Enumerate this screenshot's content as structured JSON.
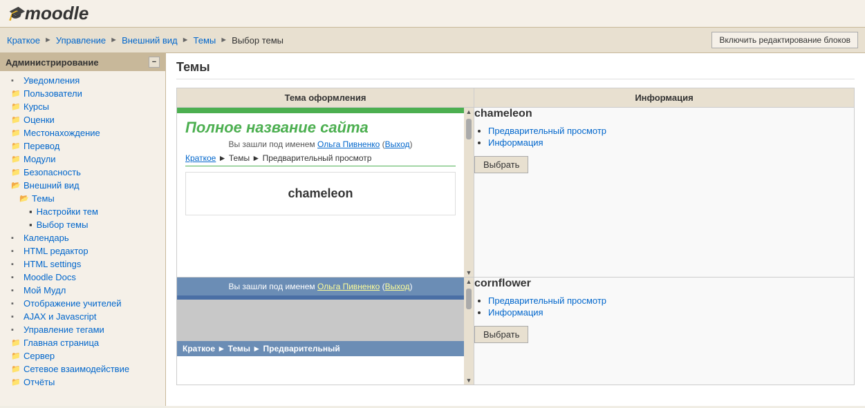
{
  "header": {
    "logo_text": "moodle",
    "logo_icon": "🎓"
  },
  "breadcrumb": {
    "items": [
      "Краткое",
      "Управление",
      "Внешний вид",
      "Темы",
      "Выбор темы"
    ],
    "edit_btn": "Включить редактирование блоков"
  },
  "sidebar": {
    "title": "Администрирование",
    "items": [
      {
        "label": "Уведомления",
        "level": 1,
        "icon": "▪"
      },
      {
        "label": "Пользователи",
        "level": 1,
        "icon": "📁"
      },
      {
        "label": "Курсы",
        "level": 1,
        "icon": "📁"
      },
      {
        "label": "Оценки",
        "level": 1,
        "icon": "📁"
      },
      {
        "label": "Местонахождение",
        "level": 1,
        "icon": "📁"
      },
      {
        "label": "Перевод",
        "level": 1,
        "icon": "📁"
      },
      {
        "label": "Модули",
        "level": 1,
        "icon": "📁"
      },
      {
        "label": "Безопасность",
        "level": 1,
        "icon": "📁"
      },
      {
        "label": "Внешний вид",
        "level": 1,
        "icon": "📂"
      },
      {
        "label": "Темы",
        "level": 2,
        "icon": "📂"
      },
      {
        "label": "Настройки тем",
        "level": 3,
        "icon": "▪"
      },
      {
        "label": "Выбор темы",
        "level": 3,
        "icon": "▪"
      },
      {
        "label": "Календарь",
        "level": 1,
        "icon": "▪"
      },
      {
        "label": "HTML редактор",
        "level": 1,
        "icon": "▪"
      },
      {
        "label": "HTML settings",
        "level": 1,
        "icon": "▪"
      },
      {
        "label": "Moodle Docs",
        "level": 1,
        "icon": "▪"
      },
      {
        "label": "Мой Мудл",
        "level": 1,
        "icon": "▪"
      },
      {
        "label": "Отображение учителей",
        "level": 1,
        "icon": "▪"
      },
      {
        "label": "AJAX и Javascript",
        "level": 1,
        "icon": "▪"
      },
      {
        "label": "Управление тегами",
        "level": 1,
        "icon": "▪"
      },
      {
        "label": "Главная страница",
        "level": 1,
        "icon": "📁"
      },
      {
        "label": "Сервер",
        "level": 1,
        "icon": "📁"
      },
      {
        "label": "Сетевое взаимодействие",
        "level": 1,
        "icon": "📁"
      },
      {
        "label": "Отчёты",
        "level": 1,
        "icon": "📁"
      }
    ]
  },
  "main": {
    "page_title": "Темы",
    "table_headers": [
      "Тема оформления",
      "Информация"
    ],
    "themes": [
      {
        "id": "chameleon",
        "name": "chameleon",
        "preview": {
          "site_title": "Полное название сайта",
          "logged_as_prefix": "Вы зашли под именем ",
          "user_name": "Ольга Пивненко",
          "logout": "Выход",
          "breadcrumb": "Краткое ► Темы ► Предварительный просмотр",
          "theme_label": "chameleon"
        },
        "info": {
          "links": [
            "Предварительный просмотр",
            "Информация"
          ],
          "select_btn": "Выбрать"
        }
      },
      {
        "id": "cornflower",
        "name": "cornflower",
        "preview": {
          "logged_as_prefix": "Вы зашли под именем ",
          "user_name": "Ольга Пивненко",
          "logout": "Выход",
          "breadcrumb": "Краткое ► Темы ► Предварительный"
        },
        "info": {
          "links": [
            "Предварительный просмотр",
            "Информация"
          ],
          "select_btn": "Выбрать"
        }
      }
    ]
  }
}
